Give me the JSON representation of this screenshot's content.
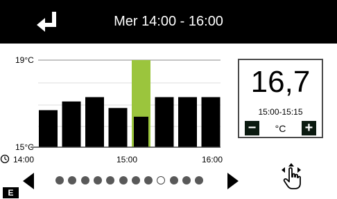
{
  "header": {
    "title": "Mer 14:00 - 16:00",
    "back_icon": "return-arrow-icon"
  },
  "chart_data": {
    "type": "bar",
    "y_top_label": "19°C",
    "y_bottom_label": "15°C",
    "ylim": [
      15,
      19
    ],
    "x_tick_labels": [
      "14:00",
      "15:00",
      "16:00"
    ],
    "values": [
      16.7,
      17.1,
      17.3,
      16.8,
      16.4,
      17.3,
      17.3,
      17.3
    ],
    "highlight_index": 4,
    "highlight_color": "#9bc53d",
    "bar_color": "#000000",
    "clock_icon": "clock-icon"
  },
  "setpoint": {
    "value": "16,7",
    "range": "15:00-15:15",
    "unit": "°C",
    "minus": "−",
    "plus": "+"
  },
  "pager": {
    "count": 12,
    "active": 8
  },
  "footer": {
    "badge": "E",
    "hand_icon": "hand-pointer-icon"
  }
}
